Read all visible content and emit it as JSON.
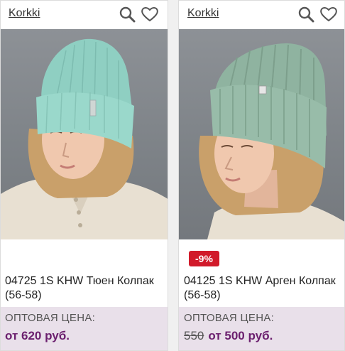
{
  "products": [
    {
      "brand": "Korkki",
      "title": "04725 1S KHW Тюен Колпак (56-58)",
      "price_label": "ОПТОВАЯ ЦЕНА:",
      "price": "от 620 руб.",
      "hat_color": "#8fcfc2",
      "icons": {
        "search": "search-icon",
        "favorite": "heart-icon"
      }
    },
    {
      "brand": "Korkki",
      "title": "04125 1S KHW Арген Колпак (56-58)",
      "discount": "-9%",
      "price_label": "ОПТОВАЯ ЦЕНА:",
      "old_price": "550",
      "price": "от 500 руб.",
      "hat_color": "#8fb3a0",
      "icons": {
        "search": "search-icon",
        "favorite": "heart-icon"
      }
    }
  ],
  "colors": {
    "price_bg": "#e9e0ea",
    "price_text": "#6b1f6e",
    "badge_bg": "#d11a2a"
  }
}
